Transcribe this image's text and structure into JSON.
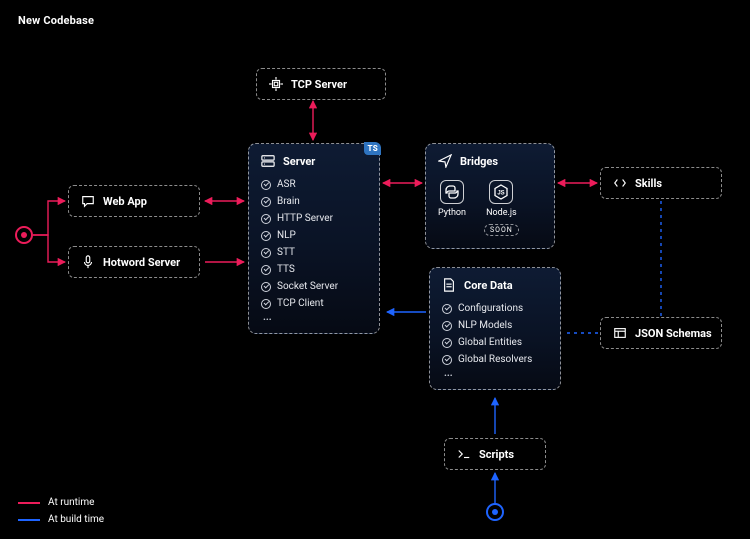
{
  "title": "New Codebase",
  "legend": {
    "runtime": "At runtime",
    "build": "At build time"
  },
  "colors": {
    "runtime": "#ec1c5a",
    "build": "#1e64ff"
  },
  "nodes": {
    "tcp_server": {
      "label": "TCP Server"
    },
    "web_app": {
      "label": "Web App"
    },
    "hotword_server": {
      "label": "Hotword Server"
    },
    "skills": {
      "label": "Skills"
    },
    "json_schemas": {
      "label": "JSON Schemas"
    },
    "scripts": {
      "label": "Scripts"
    }
  },
  "panels": {
    "server": {
      "label": "Server",
      "badge": "TS",
      "items": [
        "ASR",
        "Brain",
        "HTTP Server",
        "NLP",
        "STT",
        "TTS",
        "Socket Server",
        "TCP Client"
      ],
      "more": "..."
    },
    "bridges": {
      "label": "Bridges",
      "techs": [
        {
          "name": "Python",
          "soon": null
        },
        {
          "name": "Node.js",
          "soon": "SOON"
        }
      ]
    },
    "core_data": {
      "label": "Core Data",
      "items": [
        "Configurations",
        "NLP Models",
        "Global Entities",
        "Global Resolvers"
      ],
      "more": "..."
    }
  }
}
